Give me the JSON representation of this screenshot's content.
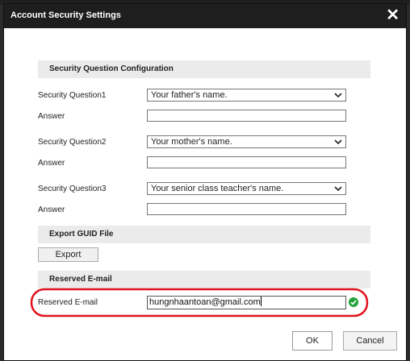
{
  "dialog": {
    "title": "Account Security Settings",
    "close_icon": "close-icon"
  },
  "security_questions": {
    "section_title": "Security Question Configuration",
    "questions": [
      {
        "label": "Security Question1",
        "selected": "Your father's name.",
        "answer_label": "Answer",
        "answer_value": ""
      },
      {
        "label": "Security Question2",
        "selected": "Your mother's name.",
        "answer_label": "Answer",
        "answer_value": ""
      },
      {
        "label": "Security Question3",
        "selected": "Your senior class teacher's name.",
        "answer_label": "Answer",
        "answer_value": ""
      }
    ]
  },
  "export_guid": {
    "section_title": "Export GUID File",
    "button_label": "Export"
  },
  "reserved_email": {
    "section_title": "Reserved E-mail",
    "label": "Reserved E-mail",
    "value": "hungnhaantoan@gmail.com",
    "status_icon": "check-circle-icon",
    "highlight_color": "#e0141e",
    "status_color": "#22a33a"
  },
  "footer": {
    "ok_label": "OK",
    "cancel_label": "Cancel"
  }
}
